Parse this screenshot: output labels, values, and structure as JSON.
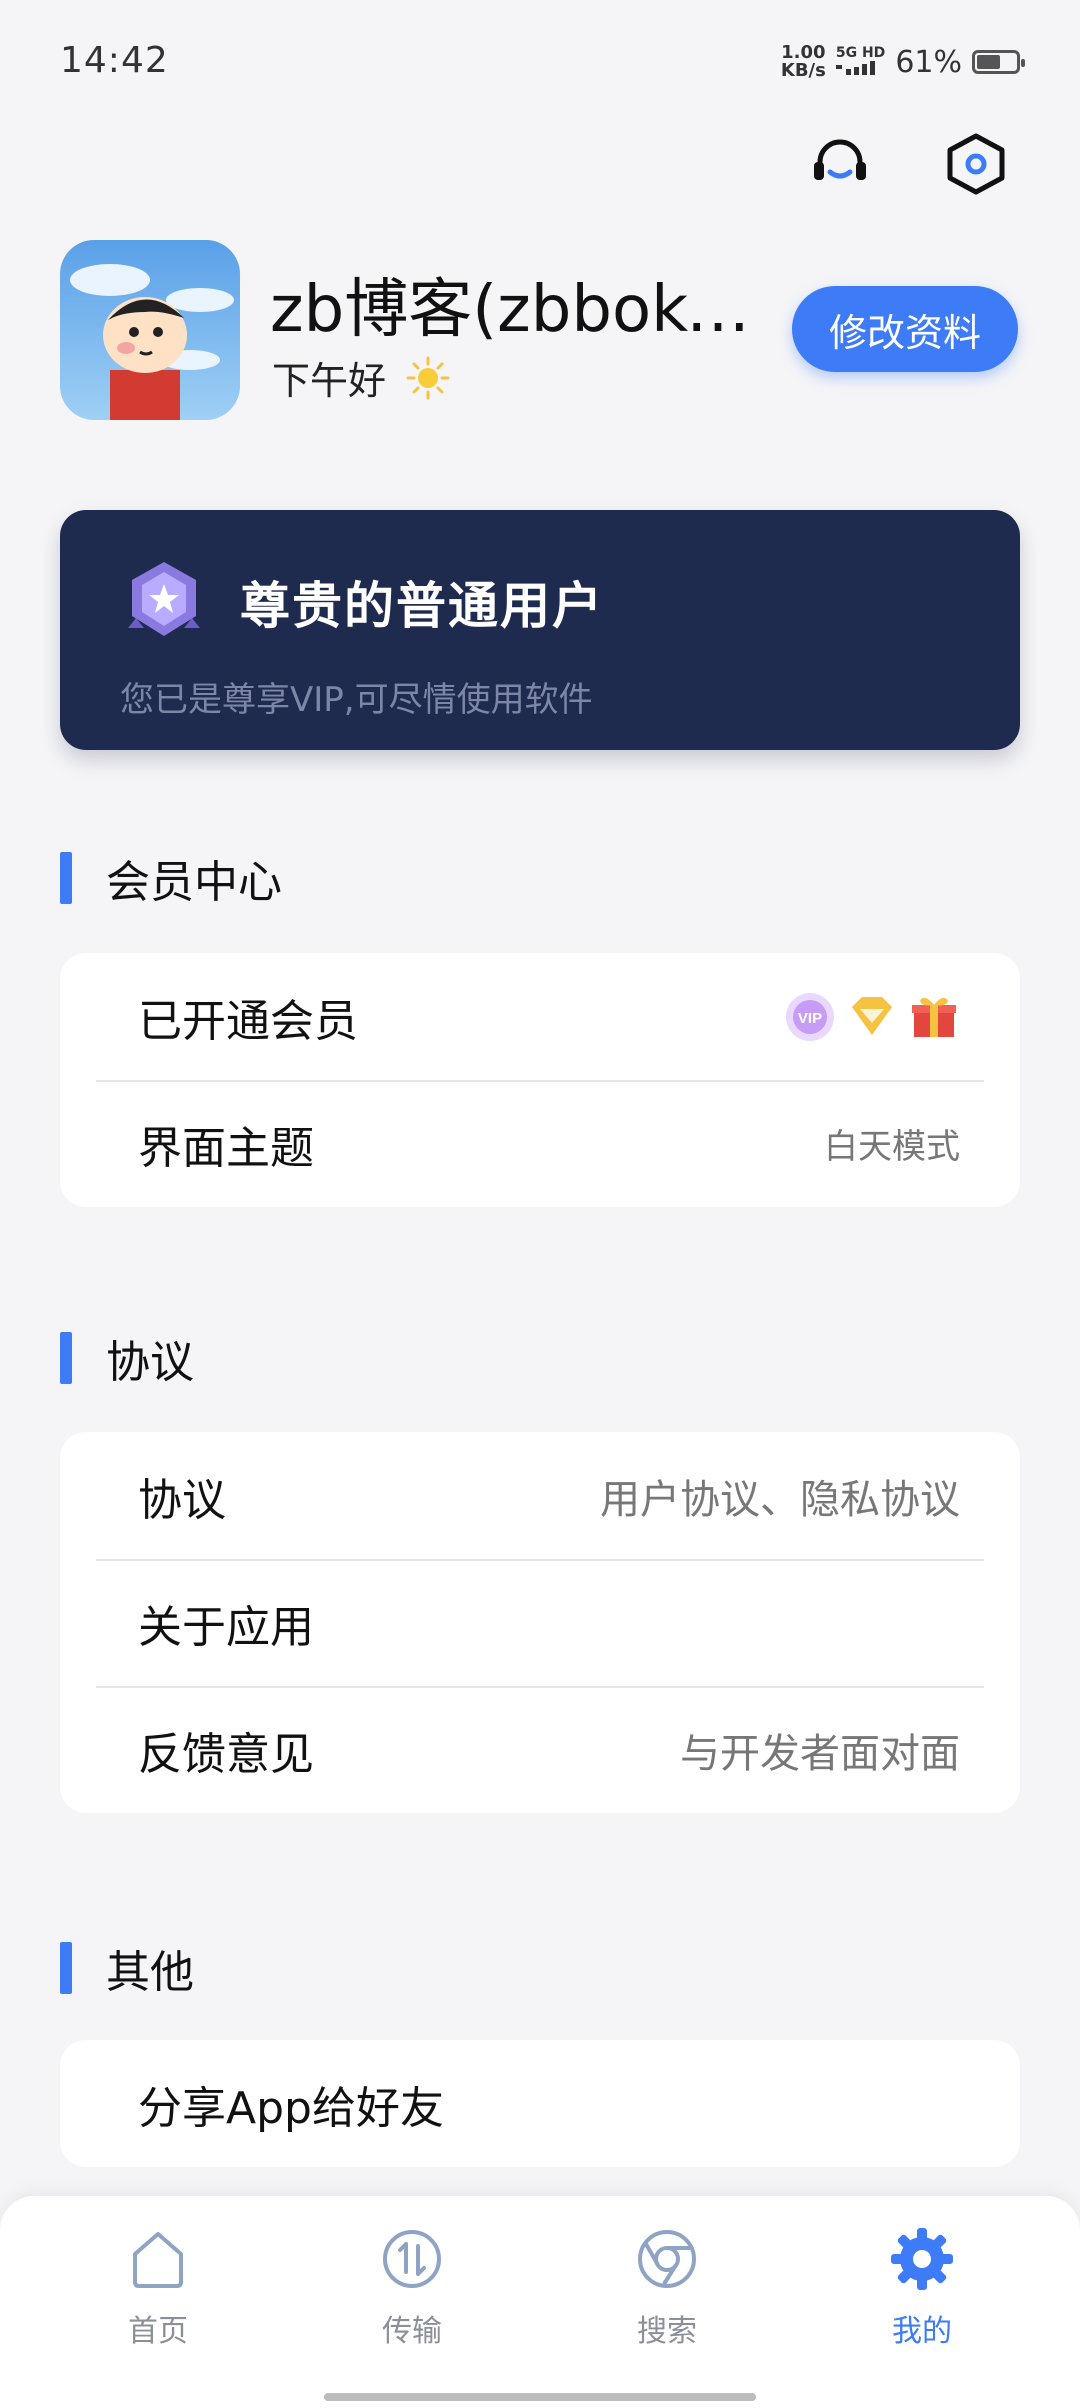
{
  "status_bar": {
    "time": "14:42",
    "speed_value": "1.00",
    "speed_unit": "KB/s",
    "network": "5G HD",
    "battery_percent": "61%",
    "battery_level": 0.61
  },
  "header_icons": {
    "support": "headset-icon",
    "settings": "settings-hexagon-icon"
  },
  "profile": {
    "username": "zb博客(zbboke…",
    "greeting": "下午好",
    "greeting_icon": "sun-icon",
    "edit_button": "修改资料"
  },
  "vip_card": {
    "title": "尊贵的普通用户",
    "subtitle": "您已是尊享VIP,可尽情使用软件",
    "bg_color": "#1f2a4f"
  },
  "sections": [
    {
      "title": "会员中心",
      "rows": [
        {
          "label": "已开通会员",
          "value": ""
        },
        {
          "label": "界面主题",
          "value": "白天模式"
        }
      ]
    },
    {
      "title": "协议",
      "rows": [
        {
          "label": "协议",
          "value": "用户协议、隐私协议"
        },
        {
          "label": "关于应用",
          "value": ""
        },
        {
          "label": "反馈意见",
          "value": "与开发者面对面"
        }
      ]
    },
    {
      "title": "其他",
      "rows": [
        {
          "label": "分享App给好友",
          "value": ""
        }
      ]
    }
  ],
  "member_badges": [
    "vip-badge-icon",
    "diamond-badge-icon",
    "gift-icon"
  ],
  "member_badge_vip_text": "VIP",
  "bottom_nav": [
    {
      "label": "首页",
      "icon": "home-icon"
    },
    {
      "label": "传输",
      "icon": "transfer-icon"
    },
    {
      "label": "搜索",
      "icon": "search-icon"
    },
    {
      "label": "我的",
      "icon": "gear-icon",
      "active": true
    }
  ],
  "colors": {
    "accent": "#3d7bf7",
    "background": "#f5f5f7"
  }
}
